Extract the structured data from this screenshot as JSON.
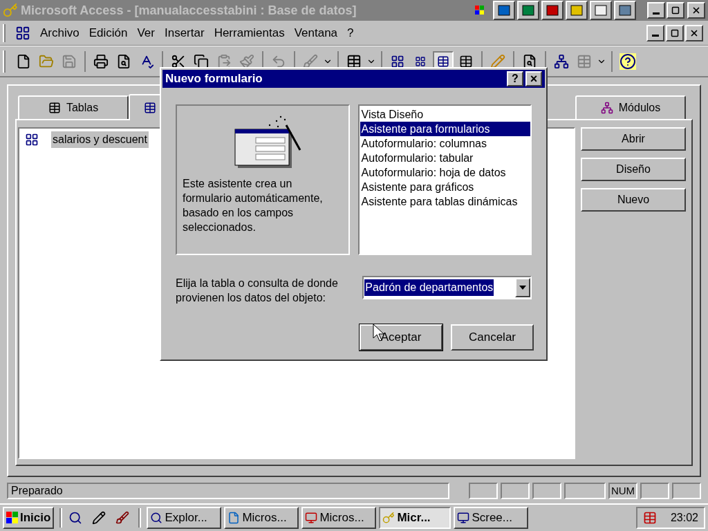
{
  "window": {
    "title": "Microsoft Access - [manualaccesstabini : Base de datos]"
  },
  "menu": [
    "Archivo",
    "Edición",
    "Ver",
    "Insertar",
    "Herramientas",
    "Ventana",
    "?"
  ],
  "database": {
    "tabs": [
      {
        "label": "Tablas",
        "selected": false
      },
      {
        "selected": true
      },
      {
        "label": "Módulos",
        "selected": false
      }
    ],
    "items": [
      {
        "label": "salarios y descuent",
        "selected": true
      }
    ],
    "buttons": [
      "Abrir",
      "Diseño",
      "Nuevo"
    ]
  },
  "dialog": {
    "title": "Nuevo formulario",
    "help": "?",
    "close": "×",
    "description": "Este asistente crea un formulario automáticamente, basado en los campos seleccionados.",
    "options": [
      {
        "label": "Vista Diseño",
        "selected": false
      },
      {
        "label": "Asistente para formularios",
        "selected": true
      },
      {
        "label": "Autoformulario: columnas",
        "selected": false
      },
      {
        "label": "Autoformulario: tabular",
        "selected": false
      },
      {
        "label": "Autoformulario: hoja de datos",
        "selected": false
      },
      {
        "label": "Asistente para gráficos",
        "selected": false
      },
      {
        "label": "Asistente para tablas dinámicas",
        "selected": false
      }
    ],
    "source_label": "Elija la tabla o consulta de donde provienen los datos del objeto:",
    "source_value": "Padrón de departamentos",
    "buttons": [
      {
        "label": "Aceptar",
        "default": true
      },
      {
        "label": "Cancelar",
        "default": false
      }
    ]
  },
  "status_bar": {
    "text": "Preparado",
    "num_indicator": "NUM"
  },
  "taskbar": {
    "start": "Inicio",
    "tasks": [
      {
        "label": "Explor...",
        "selected": false
      },
      {
        "label": "Micros...",
        "selected": false
      },
      {
        "label": "Micros...",
        "selected": false
      },
      {
        "label": "Micr...",
        "selected": true
      },
      {
        "label": "Scree...",
        "selected": false
      }
    ],
    "clock": "23:02"
  }
}
